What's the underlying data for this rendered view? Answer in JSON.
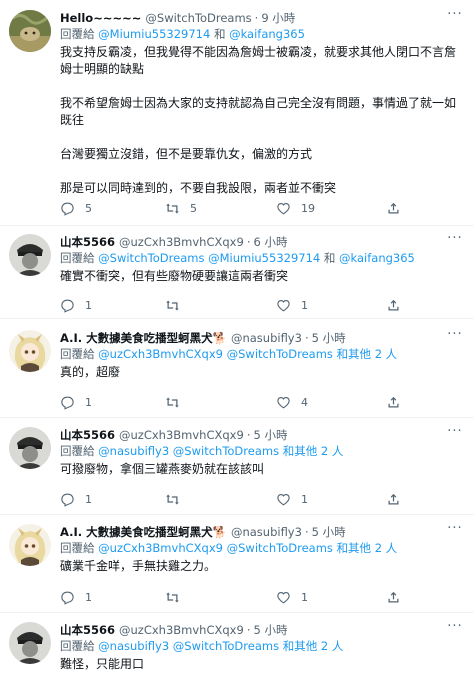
{
  "tweets": [
    {
      "name": "Hello~~~~~",
      "handle": "@SwitchToDreams",
      "sep": "·",
      "time": "9 小時",
      "reply_prefix": "回覆給",
      "reply_to": "@Miumiu55329714",
      "reply_joiner": "和",
      "reply_to_2": "@kaifang365",
      "body": [
        "我支持反霸凌，但我覺得不能因為詹姆士被霸凌，就要求其他人閉口不言詹",
        "姆士明顯的缺點",
        "",
        "我不希望詹姆士因為大家的支持就認為自己完全沒有問題，事情過了就一如",
        "既往",
        "",
        "台灣要獨立沒錯，但不是要靠仇女，偏激的方式",
        "",
        "那是可以同時達到的，不要自我設限，兩者並不衝突"
      ],
      "reply_count": "5",
      "retweet_count": "5",
      "like_count": "19"
    },
    {
      "name": "山本5566",
      "handle": "@uzCxh3BmvhCXqx9",
      "sep": "·",
      "time": "6 小時",
      "reply_prefix": "回覆給",
      "reply_to": "@SwitchToDreams",
      "reply_to_2": "@Miumiu55329714",
      "reply_joiner": "和",
      "reply_to_3": "@kaifang365",
      "body": [
        "確實不衝突，但有些廢物硬要讓這兩者衝突"
      ],
      "reply_count": "1",
      "retweet_count": "",
      "like_count": "1"
    },
    {
      "name": "A.I. 大數據美食吃播型蚵黑犬🐕",
      "handle": "@nasubifly3",
      "sep": "·",
      "time": "5 小時",
      "reply_prefix": "回覆給",
      "reply_to": "@uzCxh3BmvhCXqx9",
      "reply_to_2": "@SwitchToDreams",
      "reply_others": "和其他 2 人",
      "body": [
        "真的，超廢"
      ],
      "reply_count": "1",
      "retweet_count": "",
      "like_count": "4"
    },
    {
      "name": "山本5566",
      "handle": "@uzCxh3BmvhCXqx9",
      "sep": "·",
      "time": "5 小時",
      "reply_prefix": "回覆給",
      "reply_to": "@nasubifly3",
      "reply_to_2": "@SwitchToDreams",
      "reply_others": "和其他 2 人",
      "body": [
        "可撥廢物，拿個三罐燕麥奶就在該該叫"
      ],
      "reply_count": "1",
      "retweet_count": "",
      "like_count": "1"
    },
    {
      "name": "A.I. 大數據美食吃播型蚵黑犬🐕",
      "handle": "@nasubifly3",
      "sep": "·",
      "time": "5 小時",
      "reply_prefix": "回覆給",
      "reply_to": "@uzCxh3BmvhCXqx9",
      "reply_to_2": "@SwitchToDreams",
      "reply_others": "和其他 2 人",
      "body": [
        "礦業千金咩，手無扶雞之力。"
      ],
      "reply_count": "1",
      "retweet_count": "",
      "like_count": "1"
    },
    {
      "name": "山本5566",
      "handle": "@uzCxh3BmvhCXqx9",
      "sep": "·",
      "time": "5 小時",
      "reply_prefix": "回覆給",
      "reply_to": "@nasubifly3",
      "reply_to_2": "@SwitchToDreams",
      "reply_others": "和其他 2 人",
      "body": [
        "難怪，只能用口"
      ]
    }
  ],
  "colors": {
    "link": "#1d9bf0",
    "secondary": "#536471",
    "divider": "#eff3f4"
  },
  "icons": {
    "reply": "reply-icon",
    "retweet": "retweet-icon",
    "like": "heart-icon",
    "share": "share-icon",
    "more": "more-icon"
  }
}
